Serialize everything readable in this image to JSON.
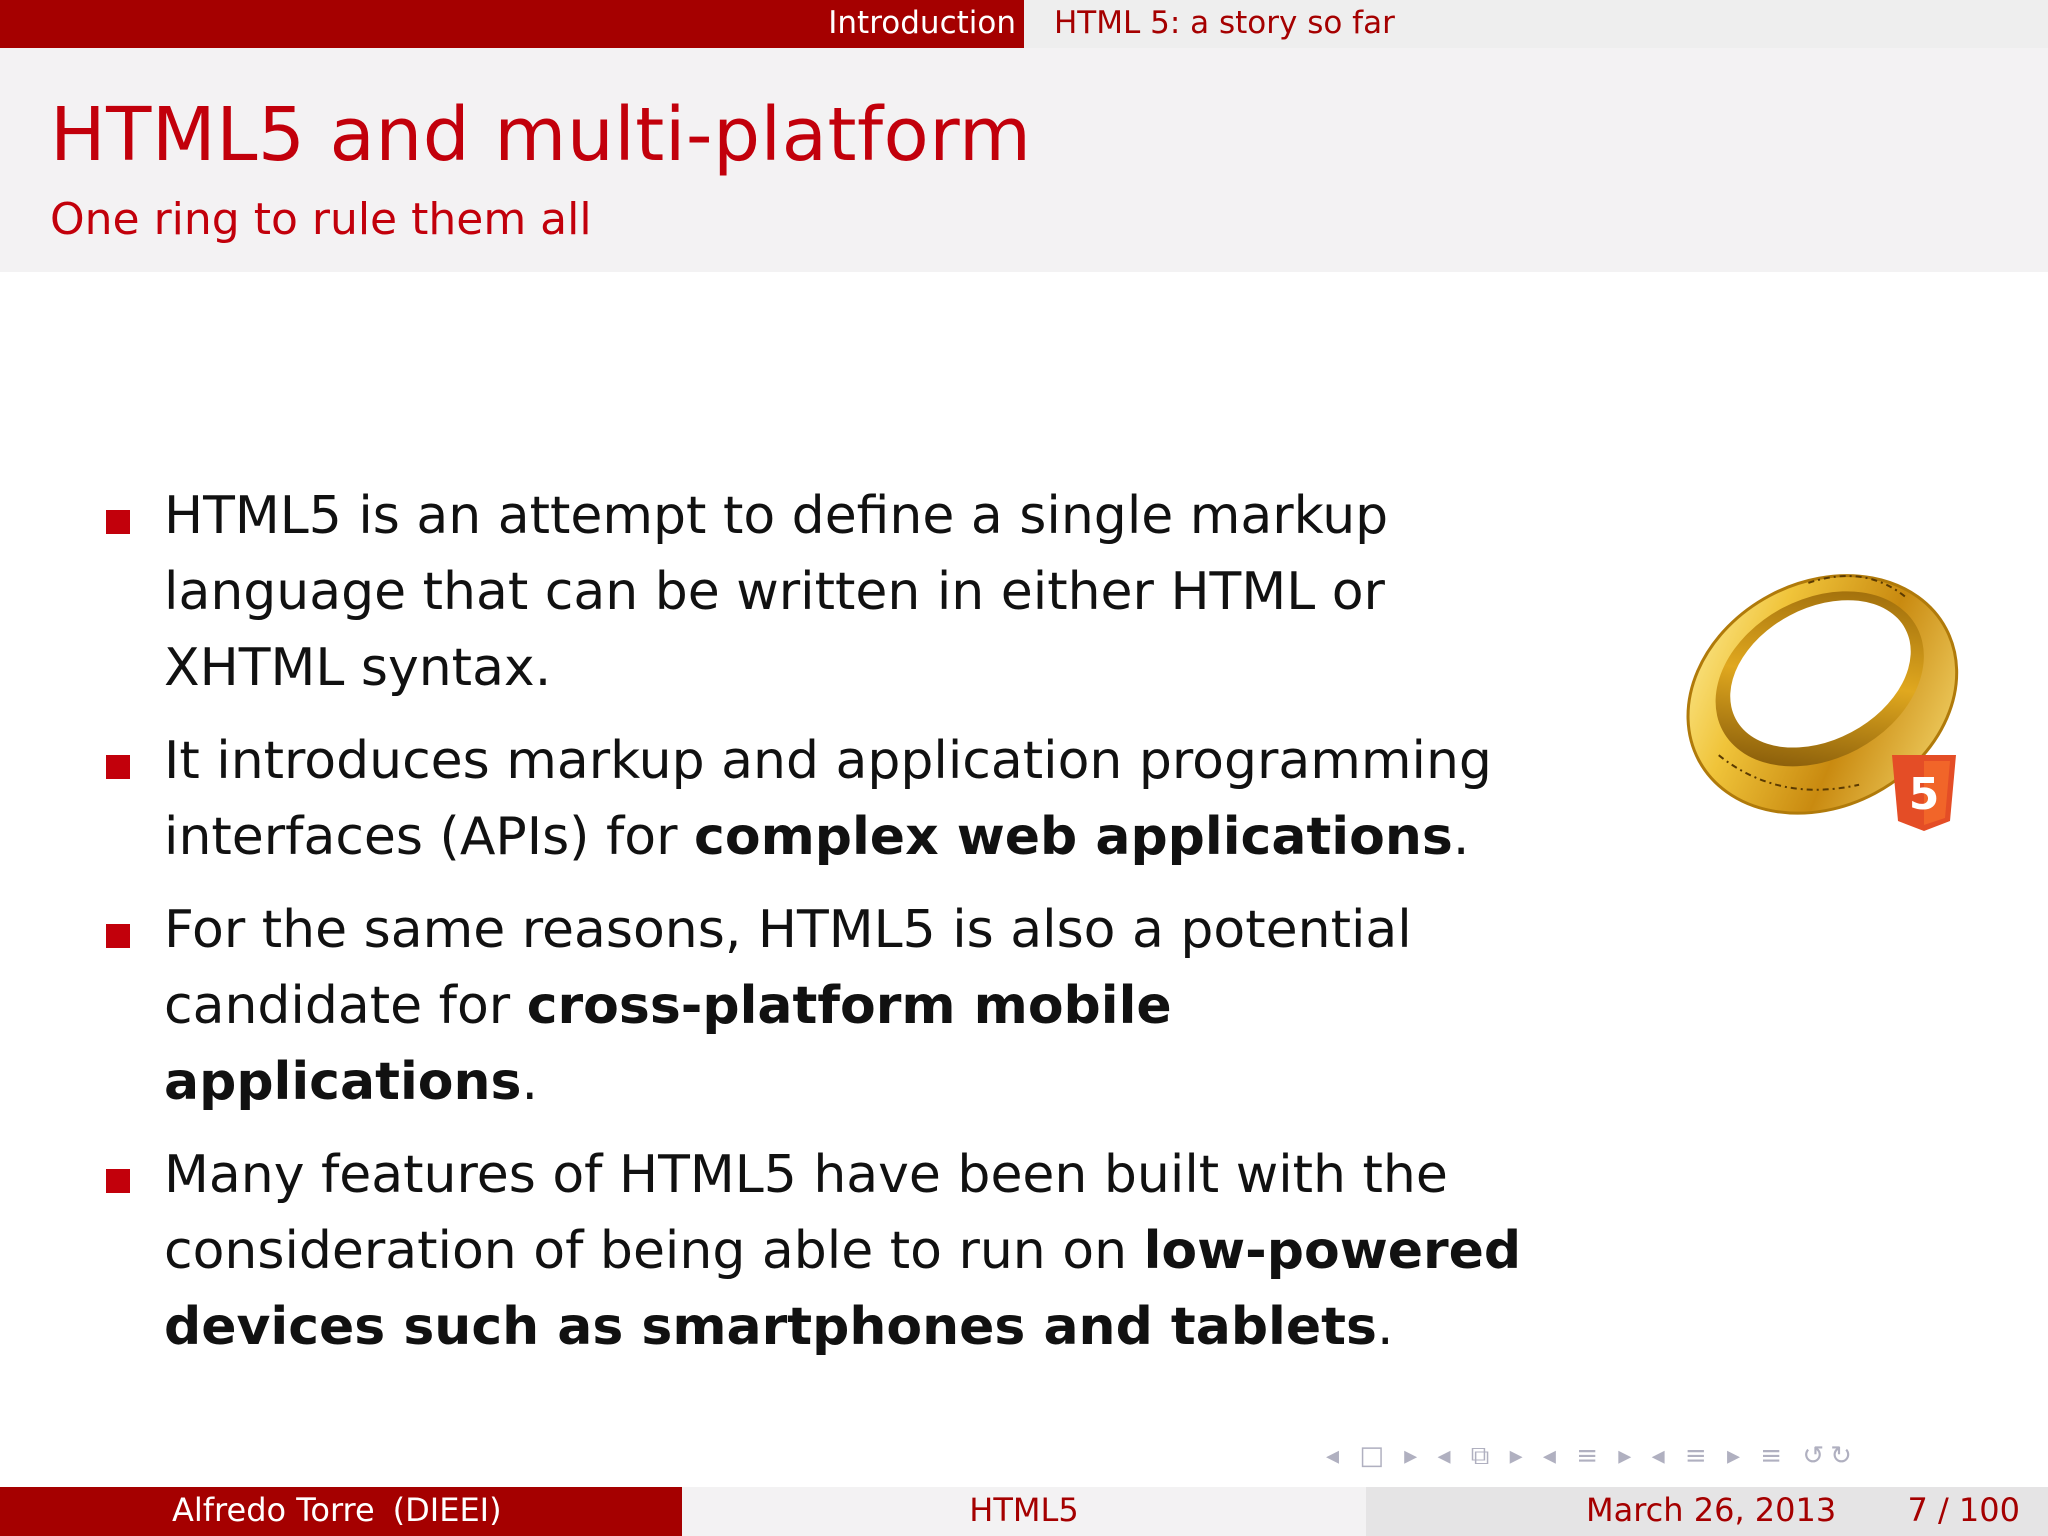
{
  "header": {
    "section": "Introduction",
    "subsection": "HTML 5: a story so far"
  },
  "slide": {
    "title": "HTML5 and multi-platform",
    "subtitle": "One ring to rule them all"
  },
  "bullets": [
    {
      "text_before": "HTML5 is an attempt to define a single markup language that can be written in either HTML or XHTML syntax.",
      "bold": "",
      "text_after": ""
    },
    {
      "text_before": "It introduces markup and application programming interfaces (APIs) for ",
      "bold": "complex web applications",
      "text_after": "."
    },
    {
      "text_before": "For the same reasons, HTML5 is also a potential candidate for ",
      "bold": "cross-platform mobile applications",
      "text_after": "."
    },
    {
      "text_before": "Many features of HTML5 have been built with the consideration of being able to run on ",
      "bold": "low-powered devices such as smartphones and tablets",
      "text_after": "."
    }
  ],
  "image": {
    "badge": "5",
    "icon": "ring-icon"
  },
  "nav_symbols": "◂ □ ▸ ◂ ⧉ ▸ ◂ ≡ ▸ ◂ ≡ ▸ ≡ ↺↻",
  "footer": {
    "author": "Alfredo Torre",
    "institute": "(DIEEI)",
    "short_title": "HTML5",
    "date": "March 26, 2013",
    "page": "7 / 100"
  },
  "colors": {
    "accent": "#a50000",
    "title_red": "#c2000b",
    "title_band": "#f3f2f3",
    "gold": "#d4a017",
    "html5_orange": "#e44d26"
  }
}
